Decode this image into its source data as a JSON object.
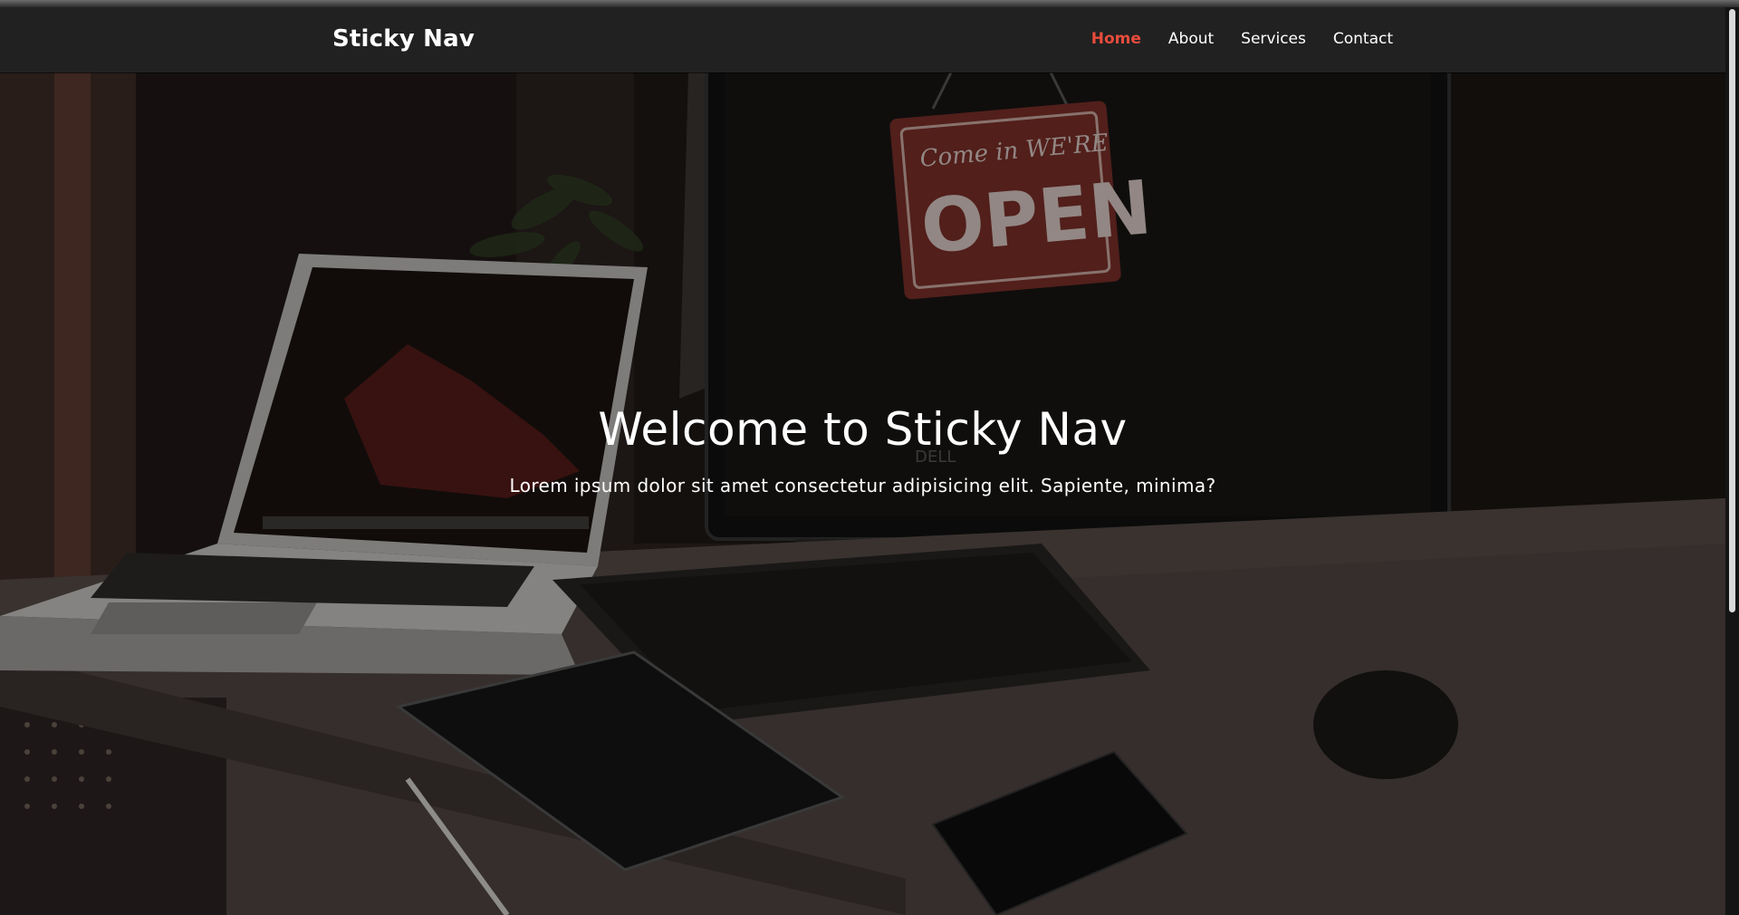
{
  "navbar": {
    "brand": "Sticky Nav",
    "links": [
      {
        "label": "Home",
        "active": true
      },
      {
        "label": "About",
        "active": false
      },
      {
        "label": "Services",
        "active": false
      },
      {
        "label": "Contact",
        "active": false
      }
    ]
  },
  "hero": {
    "title": "Welcome to Sticky Nav",
    "subtitle": "Lorem ipsum dolor sit amet consectetur adipisicing elit. Sapiente, minima?",
    "sign_text_top": "Come in WE'RE",
    "sign_text_main": "OPEN",
    "monitor_brand": "DELL"
  },
  "colors": {
    "navbar_bg": "#212121",
    "active_link": "#e74c3c",
    "text": "#ffffff"
  }
}
